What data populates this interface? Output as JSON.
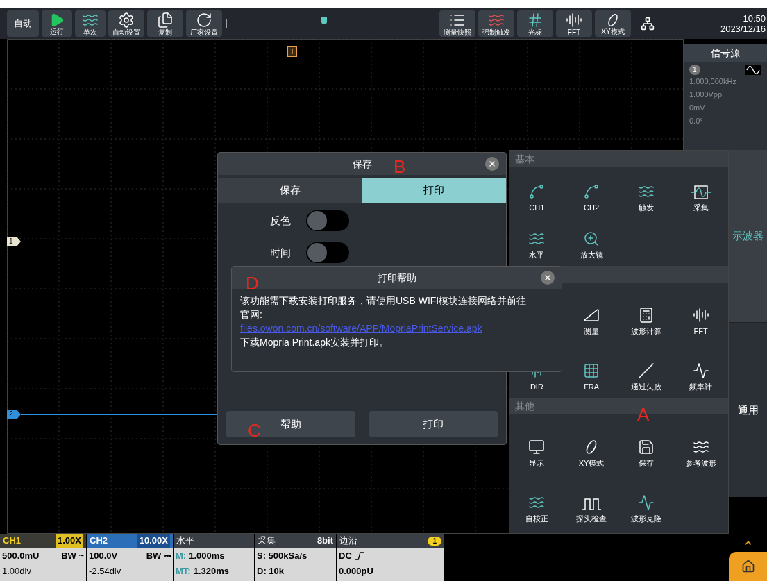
{
  "toolbar": {
    "mode": "自动",
    "left_buttons": [
      {
        "label": "运行"
      },
      {
        "label": "单次"
      },
      {
        "label": "自动设置"
      },
      {
        "label": "复制"
      },
      {
        "label": "厂家设置"
      }
    ],
    "position": {
      "level": 0.47
    },
    "right_buttons": [
      {
        "label": "测量快照"
      },
      {
        "label": "强制触发"
      },
      {
        "label": "光标"
      },
      {
        "label": "FFT"
      },
      {
        "label": "XY模式"
      }
    ],
    "time": "10:50",
    "date": "2023/12/16"
  },
  "scope": {
    "trigger_marker": "T",
    "channel_markers": [
      {
        "label": "1",
        "color": "#e8e4d0"
      },
      {
        "label": "2",
        "color": "#2f8fd8"
      }
    ]
  },
  "signal_source": {
    "title": "信号源",
    "channel": "1",
    "frequency": "1.000,000kHz",
    "amplitude": "1.000Vpp",
    "offset": "0mV",
    "phase": "0.0°"
  },
  "menu": {
    "sections": [
      {
        "title": "基本",
        "items": [
          {
            "label": "CH1"
          },
          {
            "label": "CH2"
          },
          {
            "label": "触发"
          },
          {
            "label": "采集"
          },
          {
            "label": "水平"
          },
          {
            "label": "放大镜"
          }
        ]
      },
      {
        "items": [
          {
            "label": "测量"
          },
          {
            "label": "波形计算"
          },
          {
            "label": "FFT"
          },
          {
            "label": "DIR"
          },
          {
            "label": "FRA"
          },
          {
            "label": "通过失败"
          },
          {
            "label": "频率计"
          }
        ]
      },
      {
        "title": "其他",
        "items": [
          {
            "label": "显示"
          },
          {
            "label": "XY模式"
          },
          {
            "label": "保存"
          },
          {
            "label": "参考波形"
          },
          {
            "label": "自校正"
          },
          {
            "label": "探头检查"
          },
          {
            "label": "波形克隆"
          }
        ]
      }
    ],
    "side_tabs": [
      {
        "label": "示波器",
        "selected": true
      },
      {
        "label": "通用",
        "selected": false
      }
    ]
  },
  "save_dialog": {
    "title": "保存",
    "tabs": [
      {
        "label": "保存",
        "selected": false
      },
      {
        "label": "打印",
        "selected": true
      }
    ],
    "toggles": [
      {
        "label": "反色",
        "on": false
      },
      {
        "label": "时间",
        "on": false
      }
    ],
    "buttons": [
      "帮助",
      "打印"
    ]
  },
  "help_dialog": {
    "title": "打印帮助",
    "text": "该功能需下载安装打印服务，请使用USB WIFI模块连接网络并前往官网:",
    "link": "files.owon.com.cn/software/APP/MopriaPrintService.apk",
    "footer": "下载Mopria Print.apk安装并打印。"
  },
  "annotations": [
    "A",
    "B",
    "C",
    "D"
  ],
  "status_bar": {
    "ch1": {
      "title": "CH1",
      "probe": "1.00X",
      "scale": "500.0mU",
      "bw": "BW ~",
      "offset": "1.00div"
    },
    "ch2": {
      "title": "CH2",
      "probe": "10.00X",
      "scale": "100.0V",
      "bw": "BW ⎓",
      "offset": "-2.54div"
    },
    "horizontal": {
      "title": "水平",
      "main_label": "M:",
      "main": "1.000ms",
      "delay_label": "MT:",
      "delay": "1.320ms"
    },
    "acquire": {
      "title": "采集",
      "depth": "8bit",
      "rate": "S: 500kSa/s",
      "length": "D: 10k"
    },
    "trigger": {
      "title": "边沿",
      "source": "1",
      "coupling": "DC",
      "level": "0.000pU"
    }
  }
}
